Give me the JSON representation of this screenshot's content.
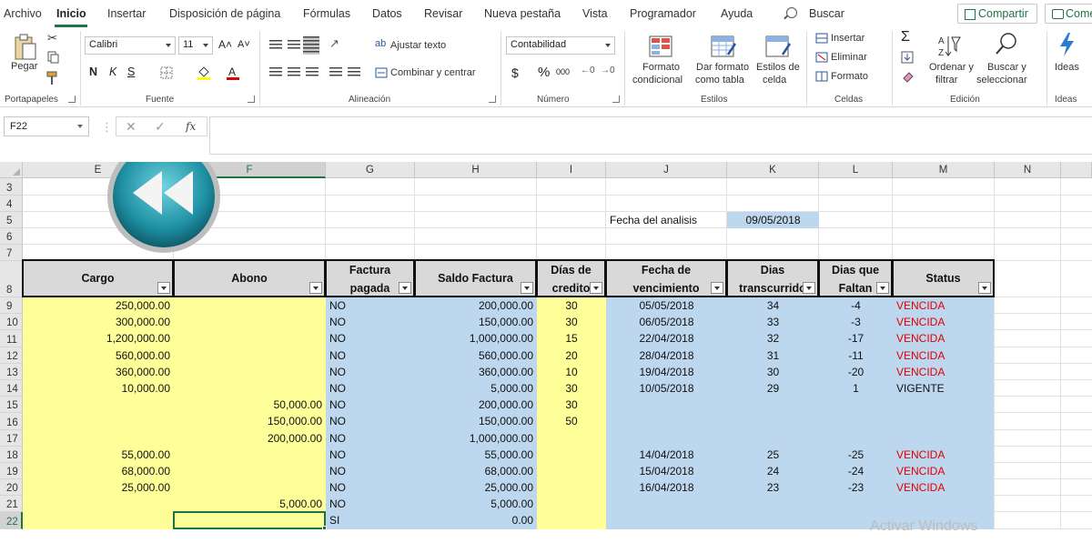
{
  "ribbon_tabs": [
    "Archivo",
    "Inicio",
    "Insertar",
    "Disposición de página",
    "Fórmulas",
    "Datos",
    "Revisar",
    "Nueva pestaña",
    "Vista",
    "Programador",
    "Ayuda"
  ],
  "search_label": "Buscar",
  "share_label": "Compartir",
  "comments_label": "Come",
  "clipboard": {
    "paste_label": "Pegar",
    "group_label": "Portapapeles"
  },
  "font": {
    "name": "Calibri",
    "size": "11",
    "bold": "N",
    "italic": "K",
    "underline": "S",
    "grow": "A˄",
    "shrink": "A˅",
    "group_label": "Fuente"
  },
  "alignment": {
    "wrap_label": "Ajustar texto",
    "merge_label": "Combinar y centrar",
    "group_label": "Alineación"
  },
  "number": {
    "format": "Contabilidad",
    "currency": "$",
    "percent": "%",
    "thousands": "000",
    "group_label": "Número"
  },
  "styles": {
    "conditional": [
      "Formato",
      "condicional"
    ],
    "table": [
      "Dar formato",
      "como tabla"
    ],
    "cell": [
      "Estilos de",
      "celda"
    ],
    "group_label": "Estilos"
  },
  "cells": {
    "insert_label": "Insertar",
    "delete_label": "Eliminar",
    "format_label": "Formato",
    "group_label": "Celdas"
  },
  "editing": {
    "sort": [
      "Ordenar y",
      "filtrar"
    ],
    "find": [
      "Buscar y",
      "seleccionar"
    ],
    "sigma": "Σ",
    "group_label": "Edición"
  },
  "ideas": {
    "label": "Ideas",
    "group_label": "Ideas"
  },
  "name_box": "F22",
  "formula_bar": {
    "cancel": "✕",
    "enter": "✓",
    "fx": "fx",
    "value": ""
  },
  "columns": [
    "E",
    "F",
    "G",
    "H",
    "I",
    "J",
    "K",
    "L",
    "M",
    "N"
  ],
  "rows": [
    "3",
    "4",
    "5",
    "6",
    "7",
    "8",
    "9",
    "10",
    "11",
    "12",
    "13",
    "14",
    "15",
    "16",
    "17",
    "18",
    "19",
    "20",
    "21",
    "22"
  ],
  "selected_column": "F",
  "selected_row": "22",
  "analysis": {
    "label": "Fecha del analisis",
    "date": "09/05/2018"
  },
  "headers": {
    "cargo": "Cargo",
    "abono": "Abono",
    "factura_pagada": [
      "Factura",
      "pagada"
    ],
    "saldo": "Saldo Factura",
    "dias_credito": [
      "Días de",
      "credito"
    ],
    "fecha_venc": [
      "Fecha de",
      "vencimiento"
    ],
    "dias_trans": [
      "Dias",
      "transcurrido"
    ],
    "dias_faltan": [
      "Dias que",
      "Faltan"
    ],
    "status": "Status"
  },
  "data_rows": [
    {
      "cargo": "250,000.00",
      "abono": "",
      "pagada": "NO",
      "saldo": "200,000.00",
      "credito": "30",
      "venc": "05/05/2018",
      "trans": "34",
      "faltan": "-4",
      "status": "VENCIDA"
    },
    {
      "cargo": "300,000.00",
      "abono": "",
      "pagada": "NO",
      "saldo": "150,000.00",
      "credito": "30",
      "venc": "06/05/2018",
      "trans": "33",
      "faltan": "-3",
      "status": "VENCIDA"
    },
    {
      "cargo": "1,200,000.00",
      "abono": "",
      "pagada": "NO",
      "saldo": "1,000,000.00",
      "credito": "15",
      "venc": "22/04/2018",
      "trans": "32",
      "faltan": "-17",
      "status": "VENCIDA"
    },
    {
      "cargo": "560,000.00",
      "abono": "",
      "pagada": "NO",
      "saldo": "560,000.00",
      "credito": "20",
      "venc": "28/04/2018",
      "trans": "31",
      "faltan": "-11",
      "status": "VENCIDA"
    },
    {
      "cargo": "360,000.00",
      "abono": "",
      "pagada": "NO",
      "saldo": "360,000.00",
      "credito": "10",
      "venc": "19/04/2018",
      "trans": "30",
      "faltan": "-20",
      "status": "VENCIDA"
    },
    {
      "cargo": "10,000.00",
      "abono": "",
      "pagada": "NO",
      "saldo": "5,000.00",
      "credito": "30",
      "venc": "10/05/2018",
      "trans": "29",
      "faltan": "1",
      "status": "VIGENTE"
    },
    {
      "cargo": "",
      "abono": "50,000.00",
      "pagada": "NO",
      "saldo": "200,000.00",
      "credito": "30",
      "venc": "",
      "trans": "",
      "faltan": "",
      "status": ""
    },
    {
      "cargo": "",
      "abono": "150,000.00",
      "pagada": "NO",
      "saldo": "150,000.00",
      "credito": "50",
      "venc": "",
      "trans": "",
      "faltan": "",
      "status": ""
    },
    {
      "cargo": "",
      "abono": "200,000.00",
      "pagada": "NO",
      "saldo": "1,000,000.00",
      "credito": "",
      "venc": "",
      "trans": "",
      "faltan": "",
      "status": ""
    },
    {
      "cargo": "55,000.00",
      "abono": "",
      "pagada": "NO",
      "saldo": "55,000.00",
      "credito": "",
      "venc": "14/04/2018",
      "trans": "25",
      "faltan": "-25",
      "status": "VENCIDA"
    },
    {
      "cargo": "68,000.00",
      "abono": "",
      "pagada": "NO",
      "saldo": "68,000.00",
      "credito": "",
      "venc": "15/04/2018",
      "trans": "24",
      "faltan": "-24",
      "status": "VENCIDA"
    },
    {
      "cargo": "25,000.00",
      "abono": "",
      "pagada": "NO",
      "saldo": "25,000.00",
      "credito": "",
      "venc": "16/04/2018",
      "trans": "23",
      "faltan": "-23",
      "status": "VENCIDA"
    },
    {
      "cargo": "",
      "abono": "5,000.00",
      "pagada": "NO",
      "saldo": "5,000.00",
      "credito": "",
      "venc": "",
      "trans": "",
      "faltan": "",
      "status": ""
    },
    {
      "cargo": "",
      "abono": "",
      "pagada": "SI",
      "saldo": "0.00",
      "credito": "",
      "venc": "",
      "trans": "",
      "faltan": "",
      "status": ""
    }
  ],
  "watermark": "Activar Windows",
  "colors": {
    "accent": "#217346",
    "yellow": "#ffff99",
    "blue": "#bdd7ee",
    "red": "#e00000"
  }
}
